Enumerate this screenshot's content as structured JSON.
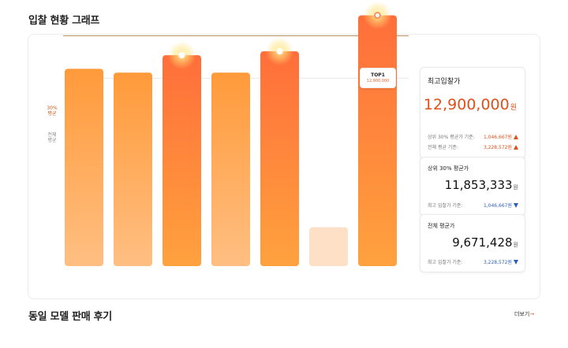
{
  "header": {
    "title": "입찰 현황 그래프"
  },
  "reviews": {
    "title": "동일 모델 판매 후기",
    "more_label": "더보기",
    "more_icon": "arrow-right-icon"
  },
  "chart_data": {
    "type": "bar",
    "categories": [
      "",
      "",
      "",
      "",
      "",
      "",
      ""
    ],
    "values": [
      10150000,
      9950000,
      10850000,
      9950000,
      11050000,
      2000000,
      12900000
    ],
    "highlighted": [
      false,
      false,
      true,
      false,
      true,
      false,
      true
    ],
    "muted": [
      false,
      false,
      false,
      false,
      false,
      true,
      false
    ],
    "ylim": [
      0,
      13000000
    ],
    "reference_lines": [
      {
        "label_lines": [
          "30%",
          "평균"
        ],
        "value": 11853333
      },
      {
        "label_lines": [
          "전체",
          "평균"
        ],
        "value": 9671428
      }
    ],
    "top_callout": {
      "label": "TOP1",
      "value": "12,900,000",
      "bar_index": 6
    },
    "colors": {
      "bar_top": "#ff8c3a",
      "bar_bottom": "#ffbf80",
      "bar_high_top": "#ff6a35",
      "bar_high_bottom": "#ffa040",
      "muted": "#fde0c6",
      "top30_line": "#b88a55",
      "avg_line": "#e8e8e8"
    }
  },
  "stats": {
    "max": {
      "title": "최고입찰가",
      "value": "12,900,000",
      "unit": "원",
      "rows": [
        {
          "label": "상위 30% 평균가 기준:",
          "value": "1,046,667원",
          "dir": "up"
        },
        {
          "label": "전체 평균 기준:",
          "value": "3,228,572원",
          "dir": "up"
        }
      ]
    },
    "top30": {
      "title": "상위 30% 평균가",
      "value": "11,853,333",
      "unit": "원",
      "row": {
        "label": "최고 입찰가 기준:",
        "value": "1,046,667원",
        "dir": "down"
      }
    },
    "avg": {
      "title": "전체 평균가",
      "value": "9,671,428",
      "unit": "원",
      "row": {
        "label": "최고 입찰가 기준:",
        "value": "3,228,572원",
        "dir": "down"
      }
    }
  }
}
